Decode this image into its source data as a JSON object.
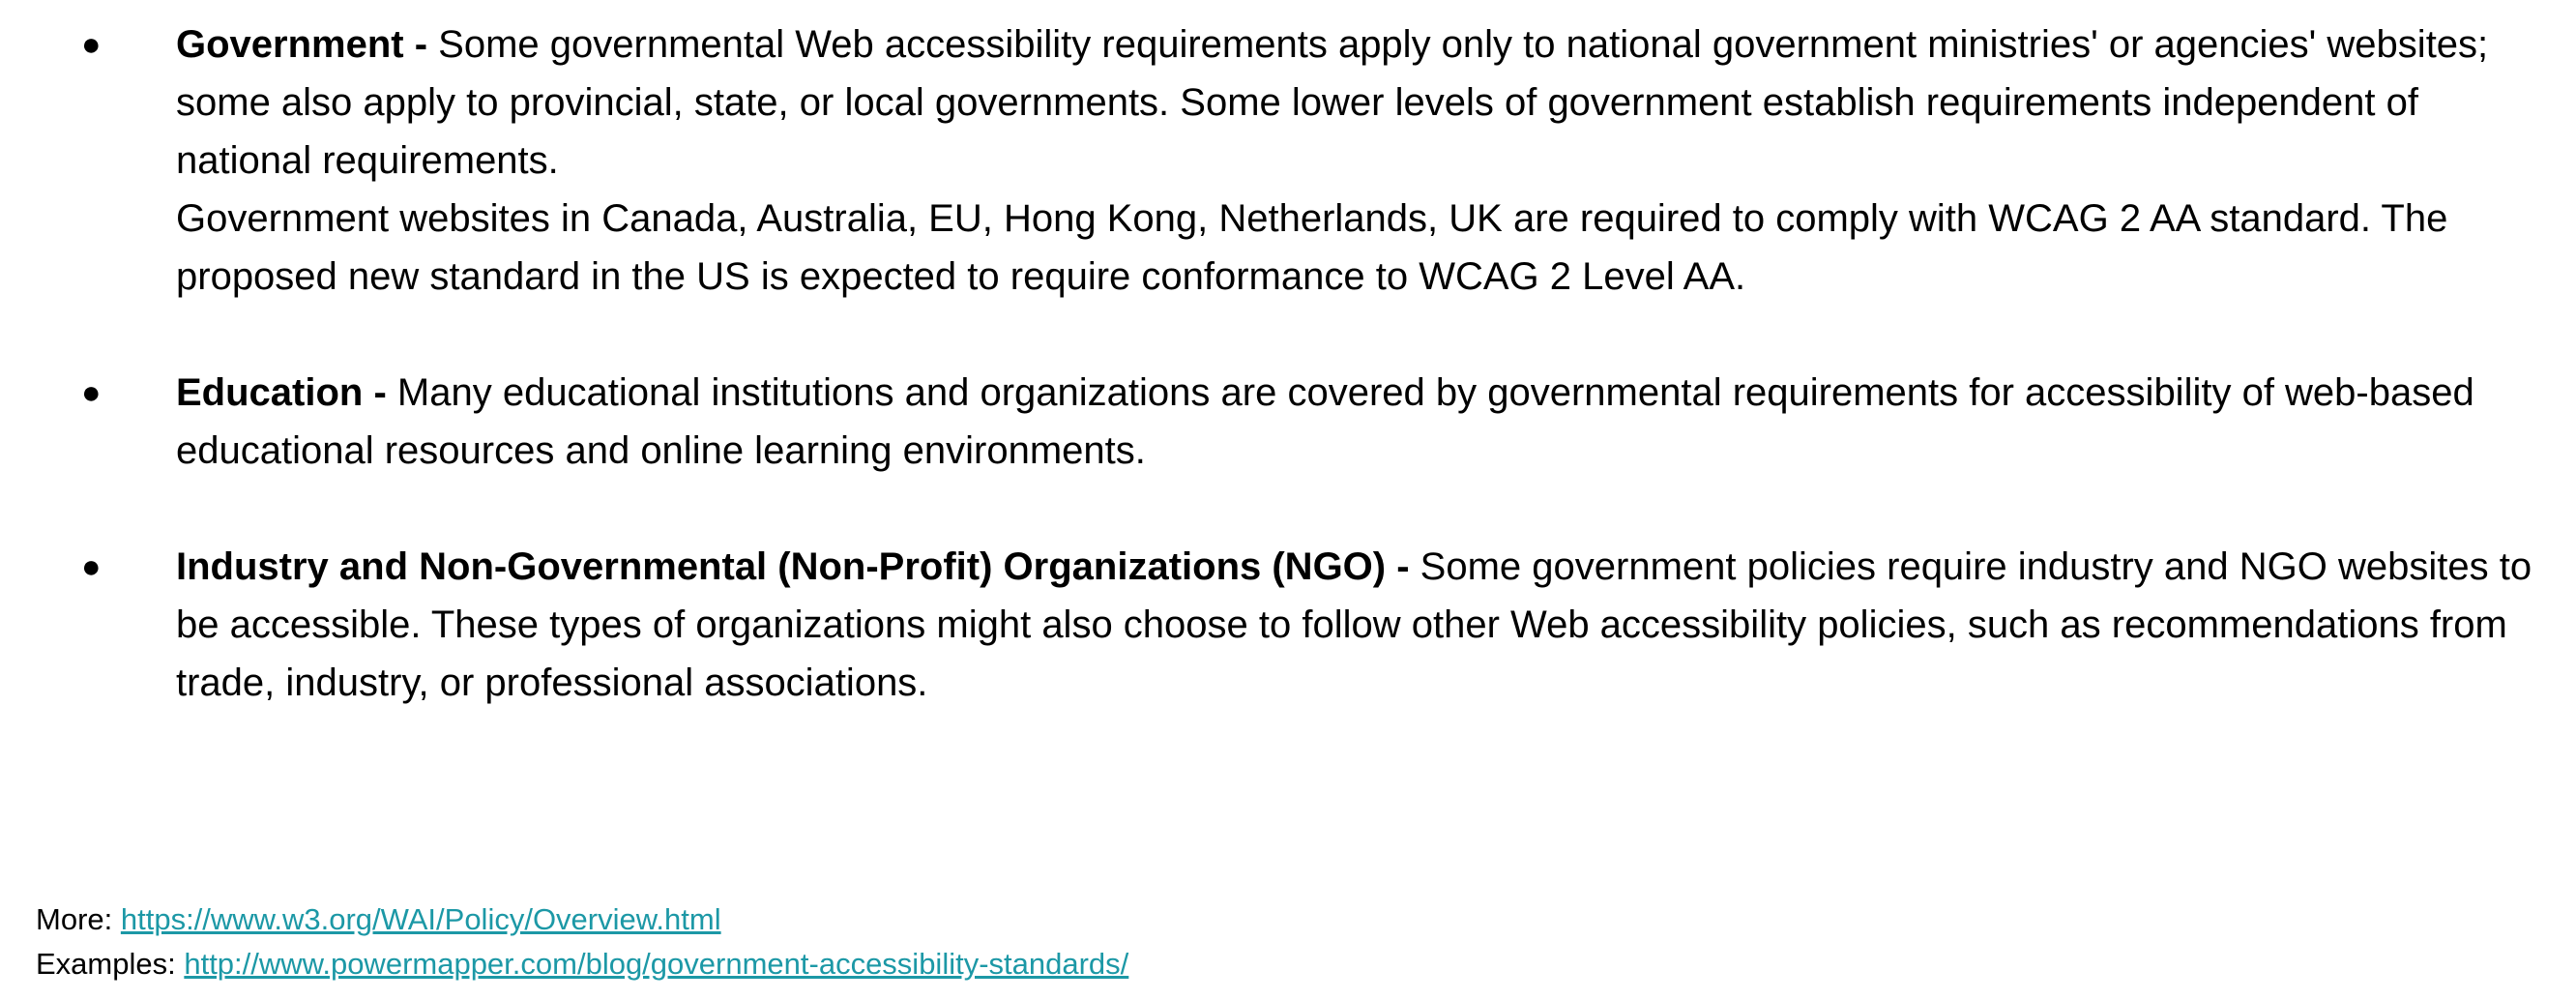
{
  "items": [
    {
      "bullet": "●",
      "title": "Government -",
      "text": " Some governmental Web accessibility requirements apply only to national government ministries' or agencies' websites; some also apply to provincial, state, or local governments. Some lower levels of government establish requirements independent of national requirements.",
      "extra": "Government websites in Canada, Australia, EU, Hong Kong, Netherlands, UK are required to comply with WCAG 2 AA standard. The proposed new standard in the US is expected to require conformance to WCAG 2 Level AA."
    },
    {
      "bullet": "●",
      "title": "Education -",
      "text": " Many educational institutions and organizations are covered by governmental requirements for accessibility of web-based educational resources and online learning environments."
    },
    {
      "bullet": "●",
      "title": "Industry and Non-Governmental (Non-Profit) Organizations (NGO) -",
      "text": " Some government policies require industry and NGO websites to be accessible. These types of organizations might also choose to follow other Web accessibility policies, such as recommendations from trade, industry, or professional associations."
    }
  ],
  "footer": {
    "more_label": "More: ",
    "more_link": "https://www.w3.org/WAI/Policy/Overview.html",
    "examples_label": "Examples: ",
    "examples_link": "http://www.powermapper.com/blog/government-accessibility-standards/"
  },
  "colors": {
    "link": "#1c98a6",
    "text": "#000000"
  }
}
